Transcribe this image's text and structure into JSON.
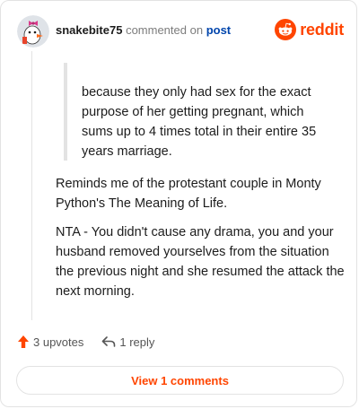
{
  "header": {
    "username": "snakebite75",
    "action_text": "commented on",
    "post_link": "post",
    "brand": "reddit"
  },
  "comment": {
    "quote": "because they only had sex for the exact purpose of her getting pregnant, which sums up to 4 times total in their entire 35 years marriage.",
    "paragraphs": [
      "Reminds me of the protestant couple in Monty Python's The Meaning of Life.",
      "NTA - You didn't cause any drama, you and your husband removed yourselves from the situation the previous night and she resumed the attack the next morning."
    ]
  },
  "actions": {
    "upvotes": "3 upvotes",
    "replies": "1 reply",
    "view_comments": "View 1 comments"
  },
  "colors": {
    "accent": "#ff4500",
    "link": "#0045ac",
    "text": "#1c1c1c",
    "muted": "#7c7c7c",
    "border": "#e3e3e3"
  },
  "icons": {
    "avatar": "snoo-avatar-icon",
    "brand": "reddit-logo-icon",
    "upvote": "upvote-arrow-icon",
    "reply": "reply-arrow-icon"
  }
}
